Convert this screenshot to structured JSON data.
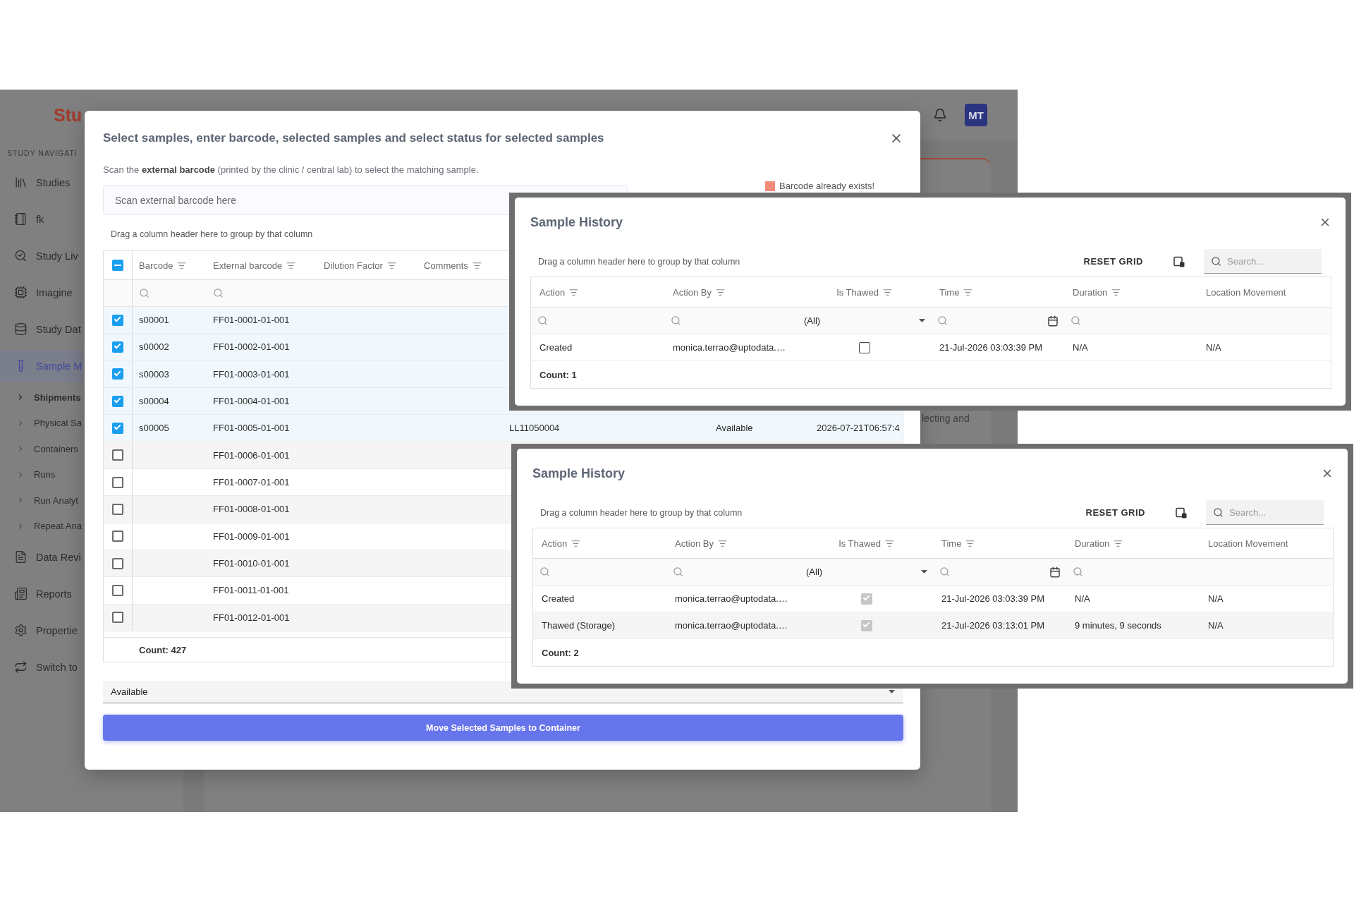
{
  "app": {
    "logo": "Stu",
    "avatar": "MT",
    "section_label": "STUDY NAVIGATI",
    "sidebar": {
      "items": [
        {
          "label": "Studies",
          "selected": false
        },
        {
          "label": "fk",
          "selected": false
        },
        {
          "label": "Study Liv",
          "selected": false
        },
        {
          "label": "Imagine",
          "selected": false
        },
        {
          "label": "Study Dat",
          "selected": false
        },
        {
          "label": "Sample M",
          "selected": true,
          "children": [
            {
              "label": "Shipments",
              "selected": true
            },
            {
              "label": "Physical Sa",
              "selected": false
            },
            {
              "label": "Containers",
              "selected": false
            },
            {
              "label": "Runs",
              "selected": false
            },
            {
              "label": "Run Analyt",
              "selected": false
            },
            {
              "label": "Repeat Ana",
              "selected": false
            }
          ]
        },
        {
          "label": "Data Revi",
          "selected": false
        },
        {
          "label": "Reports",
          "selected": false
        },
        {
          "label": "Propertie",
          "selected": false
        },
        {
          "label": "Switch to",
          "selected": false
        }
      ]
    },
    "background_text": "lecting and"
  },
  "dialog": {
    "title": "Select samples, enter barcode, selected samples and select status for selected samples",
    "instruction": "Scan the **external barcode** (printed by the clinic / central lab) to select the matching sample.",
    "barcode_field": {
      "placeholder": "Scan external barcode here"
    },
    "legend": [
      {
        "label": "Barcode already exists!",
        "color": "#f28b7a"
      }
    ],
    "group_panel": "Drag a column header here to group by that column",
    "grid": {
      "select_all": {
        "partial": true
      },
      "columns": [
        {
          "label": "Barcode",
          "header_filter": true,
          "filter": {
            "kind": "search"
          }
        },
        {
          "label": "External barcode",
          "header_filter": true,
          "filter": {
            "kind": "search"
          }
        },
        {
          "label": "Dilution Factor",
          "header_filter": true
        },
        {
          "label": "Comments",
          "header_filter": true
        }
      ],
      "rows": [
        {
          "selected": true,
          "barcode": "s00001",
          "external_barcode": "FF01-0001-01-001"
        },
        {
          "selected": true,
          "barcode": "s00002",
          "external_barcode": "FF01-0002-01-001"
        },
        {
          "selected": true,
          "barcode": "s00003",
          "external_barcode": "FF01-0003-01-001"
        },
        {
          "selected": true,
          "barcode": "s00004",
          "external_barcode": "FF01-0004-01-001"
        },
        {
          "selected": true,
          "barcode": "s00005",
          "external_barcode": "FF01-0005-01-001",
          "column_5": "LL11050004",
          "column_6": "Available",
          "column_7": "2026-07-21T06:57:4"
        },
        {
          "selected": false,
          "external_barcode": "FF01-0006-01-001"
        },
        {
          "selected": false,
          "external_barcode": "FF01-0007-01-001"
        },
        {
          "selected": false,
          "external_barcode": "FF01-0008-01-001"
        },
        {
          "selected": false,
          "external_barcode": "FF01-0009-01-001"
        },
        {
          "selected": false,
          "external_barcode": "FF01-0010-01-001"
        },
        {
          "selected": false,
          "external_barcode": "FF01-0011-01-001"
        },
        {
          "selected": false,
          "external_barcode": "FF01-0012-01-001"
        }
      ],
      "count": "Count: 427"
    },
    "status_select": {
      "value": "Available"
    },
    "submit_button": "Move Selected Samples to Container"
  },
  "history_windows": [
    {
      "title": "Sample History",
      "group_panel": "Drag a column header here to group by that column",
      "reset_button": "RESET GRID",
      "search": {
        "placeholder": "Search..."
      },
      "columns": [
        {
          "label": "Action",
          "kind": "text",
          "header_filter": true,
          "filter": {
            "kind": "search"
          }
        },
        {
          "label": "Action By",
          "kind": "text",
          "header_filter": true,
          "filter": {
            "kind": "search"
          }
        },
        {
          "label": "Is Thawed",
          "kind": "boolean",
          "header_filter": true,
          "filter": {
            "kind": "select",
            "value": "(All)"
          }
        },
        {
          "label": "Time",
          "kind": "text",
          "header_filter": true,
          "filter": {
            "kind": "date"
          }
        },
        {
          "label": "Duration",
          "kind": "text",
          "header_filter": true,
          "filter": {
            "kind": "search"
          }
        },
        {
          "label": "Location Movement",
          "kind": "text",
          "header_filter": false
        }
      ],
      "rows": [
        {
          "action": "Created",
          "action_by": "monica.terrao@uptodata.…",
          "is_thawed": false,
          "time": "21-Jul-2026 03:03:39 PM",
          "duration": "N/A",
          "location_movement": "N/A"
        }
      ],
      "count": "Count: 1"
    },
    {
      "title": "Sample History",
      "group_panel": "Drag a column header here to group by that column",
      "reset_button": "RESET GRID",
      "search": {
        "placeholder": "Search..."
      },
      "columns": [
        {
          "label": "Action",
          "kind": "text",
          "header_filter": true,
          "filter": {
            "kind": "search"
          }
        },
        {
          "label": "Action By",
          "kind": "text",
          "header_filter": true,
          "filter": {
            "kind": "search"
          }
        },
        {
          "label": "Is Thawed",
          "kind": "boolean",
          "header_filter": true,
          "filter": {
            "kind": "select",
            "value": "(All)"
          }
        },
        {
          "label": "Time",
          "kind": "text",
          "header_filter": true,
          "filter": {
            "kind": "date"
          }
        },
        {
          "label": "Duration",
          "kind": "text",
          "header_filter": true,
          "filter": {
            "kind": "search"
          }
        },
        {
          "label": "Location Movement",
          "kind": "text",
          "header_filter": false
        }
      ],
      "rows": [
        {
          "action": "Created",
          "action_by": "monica.terrao@uptodata.…",
          "is_thawed": true,
          "time": "21-Jul-2026 03:03:39 PM",
          "duration": "N/A",
          "location_movement": "N/A"
        },
        {
          "action": "Thawed (Storage)",
          "action_by": "monica.terrao@uptodata.…",
          "is_thawed": true,
          "time": "21-Jul-2026 03:13:01 PM",
          "duration": "9 minutes, 9 seconds",
          "location_movement": "N/A"
        }
      ],
      "count": "Count: 2"
    }
  ]
}
